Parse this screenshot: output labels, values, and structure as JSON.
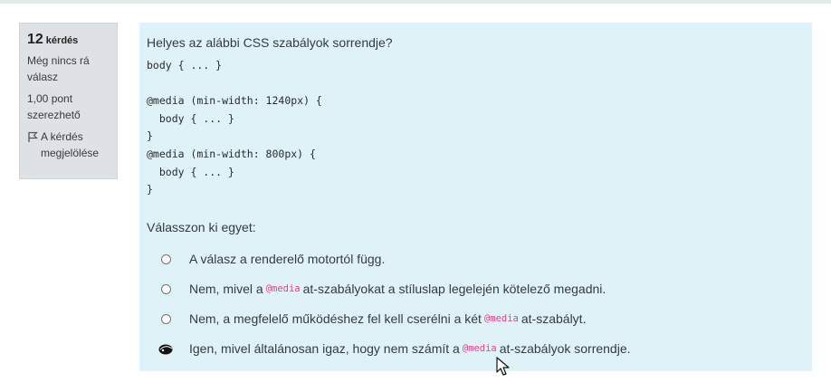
{
  "question_info": {
    "number": "12",
    "number_label": "kérdés",
    "state": "Még nincs rá válasz",
    "grade": "1,00 pont szerezhető",
    "flag_label": "A kérdés megjelölése",
    "flag_icon": "flag-icon"
  },
  "question": {
    "text": "Helyes az alábbi CSS szabályok sorrendje?",
    "code": "body { ... }\n\n@media (min-width: 1240px) {\n  body { ... }\n}\n@media (min-width: 800px) {\n  body { ... }\n}",
    "prompt": "Válasszon ki egyet:"
  },
  "answers": [
    {
      "before": "A válasz a renderelő motortól függ.",
      "code": "",
      "after": ""
    },
    {
      "before": "Nem, mivel a",
      "code": "@media",
      "after": "at-szabályokat a stíluslap legelején kötelező megadni."
    },
    {
      "before": "Nem, a megfelelő működéshez fel kell cserélni a két",
      "code": "@media",
      "after": "at-szabályt."
    },
    {
      "before": "Igen, mivel általánosan igaz, hogy nem számít a",
      "code": "@media",
      "after": "at-szabályok sorrendje."
    }
  ],
  "colors": {
    "content_bg": "#def2f8",
    "info_bg": "#dee2e6",
    "code_inline": "#e83e8c",
    "text": "#373a3c"
  }
}
